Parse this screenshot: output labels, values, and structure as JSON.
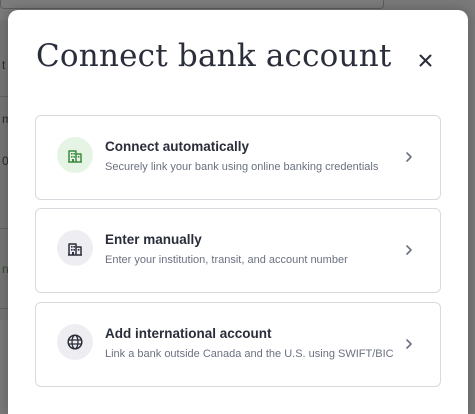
{
  "background": {
    "fragments": [
      "t",
      "m",
      "0",
      "n"
    ]
  },
  "modal": {
    "title": "Connect bank account",
    "close_icon": "close-icon",
    "options": [
      {
        "title": "Connect automatically",
        "description": "Securely link your bank using online banking credentials",
        "icon": "bank-building-icon",
        "icon_bg": "#e6f4e6",
        "icon_color": "#3d8a3d"
      },
      {
        "title": "Enter manually",
        "description": "Enter your institution, transit, and account number",
        "icon": "bank-building-icon",
        "icon_bg": "#eeeef2",
        "icon_color": "#2a2d3a"
      },
      {
        "title": "Add international account",
        "description": "Link a bank outside Canada and the U.S. using SWIFT/BIC",
        "icon": "globe-icon",
        "icon_bg": "#eeeef2",
        "icon_color": "#2a2d3a"
      }
    ]
  },
  "colors": {
    "title": "#2a2d3a",
    "description": "#6b7180",
    "card_border": "#d8dadf",
    "chevron": "#6b7180",
    "overlay": "#7a7a7a"
  }
}
